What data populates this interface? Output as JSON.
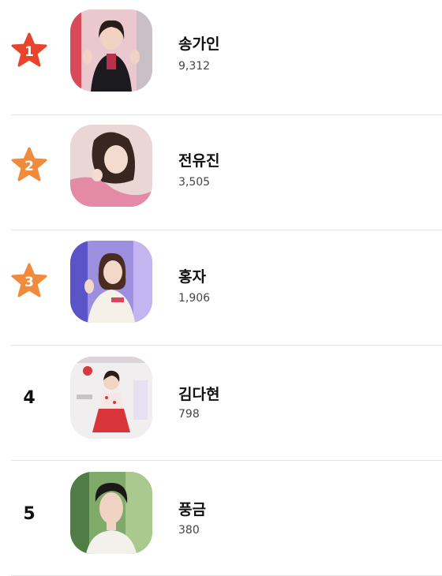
{
  "ranking": {
    "items": [
      {
        "rank": "1",
        "name": "송가인",
        "count": "9,312",
        "badge": "star",
        "star_color": "#e8442c"
      },
      {
        "rank": "2",
        "name": "전유진",
        "count": "3,505",
        "badge": "star",
        "star_color": "#f08a3c"
      },
      {
        "rank": "3",
        "name": "홍자",
        "count": "1,906",
        "badge": "star",
        "star_color": "#f08a3c"
      },
      {
        "rank": "4",
        "name": "김다현",
        "count": "798",
        "badge": "number"
      },
      {
        "rank": "5",
        "name": "풍금",
        "count": "380",
        "badge": "number"
      }
    ]
  }
}
